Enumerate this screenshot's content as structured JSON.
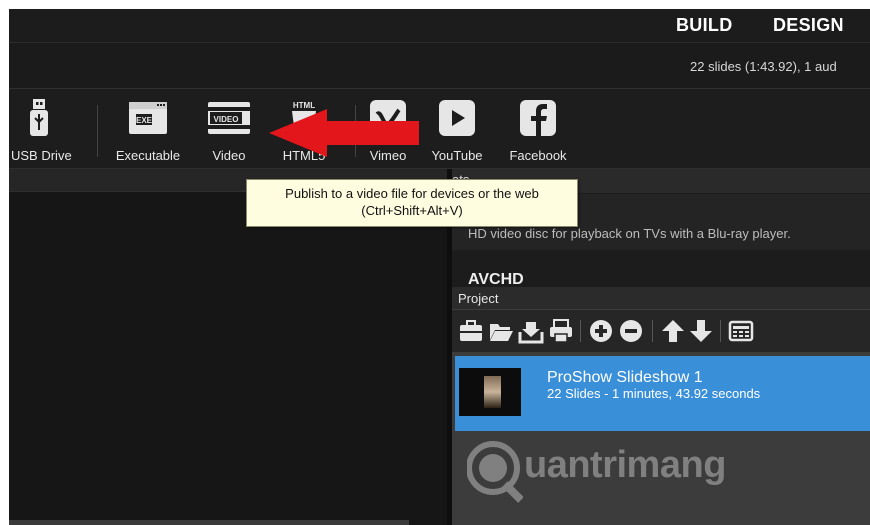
{
  "header": {
    "build_tab": "BUILD",
    "design_tab": "DESIGN"
  },
  "info": {
    "summary": "22 slides (1:43.92), 1 aud"
  },
  "toolbar": {
    "usb_drive": "USB Drive",
    "executable": "Executable",
    "video": "Video",
    "html5": "HTML5",
    "vimeo": "Vimeo",
    "youtube": "YouTube",
    "facebook": "Facebook"
  },
  "tooltip": {
    "line1": "Publish to a video file for devices or the web",
    "line2": "(Ctrl+Shift+Alt+V)"
  },
  "formats": {
    "header_text": "ats",
    "items": [
      {
        "title": "",
        "desc": "HD video disc for playback on TVs with a Blu-ray player."
      },
      {
        "title": "AVCHD"
      }
    ]
  },
  "project": {
    "header": "Project",
    "show": {
      "name": "ProShow Slideshow 1",
      "meta": "22 Slides - 1 minutes, 43.92 seconds"
    }
  },
  "watermark": {
    "text": "uantrimang"
  },
  "colors": {
    "accent_selection": "#3a8fd9",
    "arrow": "#e3161b",
    "tooltip_bg": "#fffde0"
  }
}
